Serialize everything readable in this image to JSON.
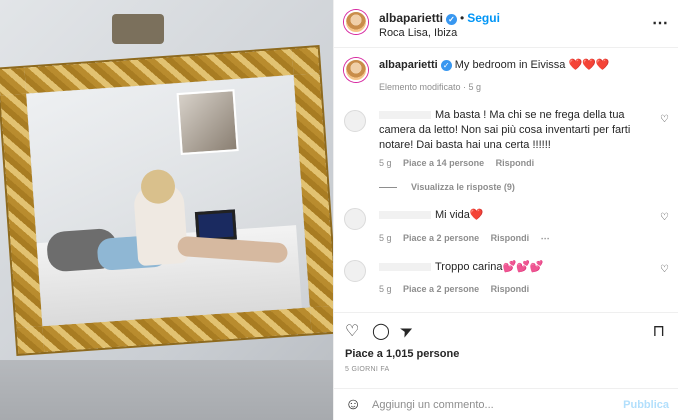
{
  "post": {
    "username": "albaparietti",
    "follow_label": "Segui",
    "location": "Roca Lisa, Ibiza",
    "caption": "My bedroom in Eivissa",
    "caption_emoji": "❤️❤️❤️",
    "edited_label": "Elemento modificato",
    "edited_time": "5 g"
  },
  "comments": [
    {
      "text": "Ma basta ! Ma chi se ne frega della tua camera da letto! Non sai più cosa inventarti per farti notare! Dai basta hai una certa !!!!!!",
      "time": "5 g",
      "likes": "Piace a 14 persone",
      "reply": "Rispondi",
      "view_replies": "Visualizza le risposte (9)"
    },
    {
      "text": "Mi vida",
      "emoji": "❤️",
      "time": "5 g",
      "likes": "Piace a 2 persone",
      "reply": "Rispondi"
    },
    {
      "text": "Troppo carina",
      "emoji": "💕💕💕",
      "time": "5 g",
      "likes": "Piace a 2 persone",
      "reply": "Rispondi"
    }
  ],
  "footer": {
    "likes": "Piace a 1,015 persone",
    "date": "5 GIORNI FA",
    "comment_placeholder": "Aggiungi un commento...",
    "publish_label": "Pubblica"
  },
  "icons": {
    "more": "⋯",
    "heart": "♡",
    "comment": "◯",
    "share": "➤",
    "bookmark": "⊓",
    "emoji": "☺",
    "verified": "✓"
  },
  "colors": {
    "accent": "#0095f6",
    "verified": "#3897f0",
    "muted": "#8e8e8e",
    "publish_disabled": "#b2dffc"
  }
}
